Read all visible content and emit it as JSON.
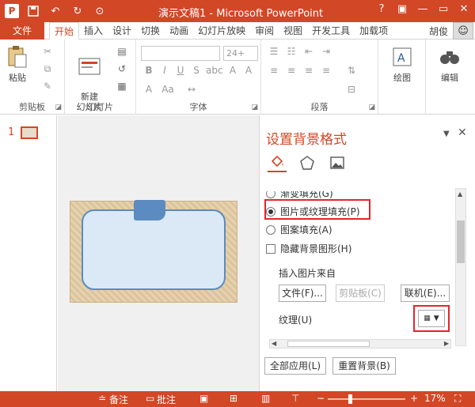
{
  "titlebar": {
    "logo": "P",
    "title": "演示文稿1 - Microsoft PowerPoint",
    "qat_icons": [
      "save-icon",
      "undo-icon",
      "redo-icon",
      "present-icon"
    ],
    "window_controls": [
      "?",
      "▣",
      "—",
      "▭",
      "✕"
    ]
  },
  "tabs": {
    "file_label": "文件",
    "items": [
      "开始",
      "插入",
      "设计",
      "切换",
      "动画",
      "幻灯片放映",
      "审阅",
      "视图",
      "开发工具",
      "加载项"
    ],
    "active": "开始",
    "user": "胡俊"
  },
  "ribbon": {
    "clipboard": {
      "paste_label": "粘贴",
      "group_label": "剪贴板"
    },
    "slides": {
      "new_slide_label": "新建\n幻灯片",
      "group_label": "幻灯片"
    },
    "font": {
      "size_value": "24+",
      "group_label": "字体"
    },
    "paragraph": {
      "group_label": "段落"
    },
    "drawing": {
      "label": "绘图"
    },
    "editing": {
      "label": "编辑"
    }
  },
  "thumbnails": {
    "slide_number": "1"
  },
  "format_pane": {
    "title": "设置背景格式",
    "options": {
      "gradient_fill": "渐变填充(G)",
      "picture_fill": "图片或纹理填充(P)",
      "pattern_fill": "图案填充(A)",
      "hide_background": "隐藏背景图形(H)"
    },
    "insert_from_label": "插入图片来自",
    "file_button": "文件(F)...",
    "clipboard_button": "剪贴板(C)",
    "online_button": "联机(E)...",
    "texture_label": "纹理(U)",
    "apply_all_button": "全部应用(L)",
    "reset_button": "重置背景(B)"
  },
  "statusbar": {
    "notes_label": "备注",
    "comments_label": "批注",
    "zoom_value": "17%"
  },
  "colors": {
    "accent": "#d24726",
    "highlight": "#e3242b",
    "slide_bg": "#e2caa1",
    "card_fill": "#dbe9f7",
    "card_border": "#5b8bc0"
  }
}
